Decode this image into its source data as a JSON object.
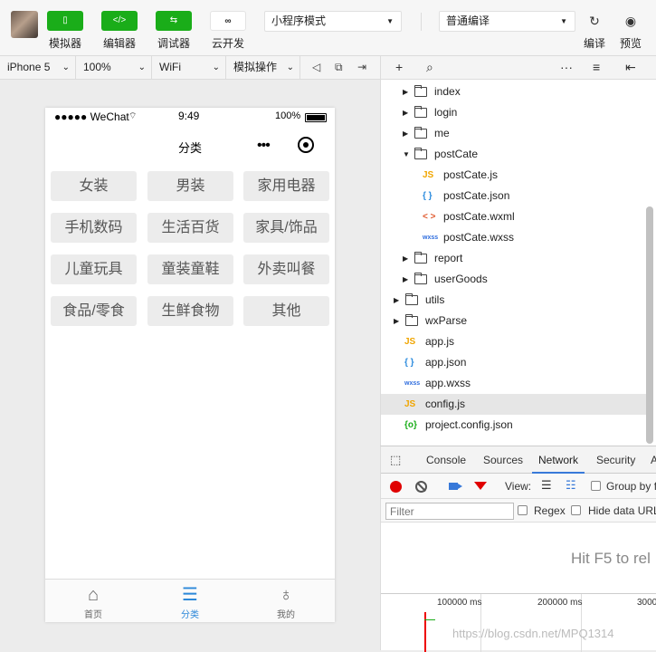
{
  "toolbar": {
    "buttons": [
      {
        "label": "模拟器",
        "icon": "phone-icon"
      },
      {
        "label": "编辑器",
        "icon": "code-icon"
      },
      {
        "label": "调试器",
        "icon": "debug-icon"
      },
      {
        "label": "云开发",
        "icon": "cloud-icon"
      }
    ],
    "mode_select": "小程序模式",
    "compile_select": "普通编译",
    "compile_label": "编译",
    "preview_label": "预览"
  },
  "simbar": {
    "device": "iPhone 5",
    "zoom": "100%",
    "network": "WiFi",
    "ops": "模拟操作"
  },
  "phone": {
    "status": {
      "carrier": "●●●●● WeChat",
      "time": "9:49",
      "battery": "100%"
    },
    "nav_title": "分类",
    "capsule_dots": "•••",
    "categories": [
      "女装",
      "男装",
      "家用电器",
      "手机数码",
      "生活百货",
      "家具/饰品",
      "儿童玩具",
      "童装童鞋",
      "外卖叫餐",
      "食品/零食",
      "生鲜食物",
      "其他"
    ],
    "tabs": [
      {
        "label": "首页",
        "icon": "home-icon"
      },
      {
        "label": "分类",
        "icon": "category-search-icon"
      },
      {
        "label": "我的",
        "icon": "user-icon"
      }
    ]
  },
  "tree": {
    "items": [
      {
        "name": "index",
        "type": "folder",
        "expanded": false
      },
      {
        "name": "login",
        "type": "folder",
        "expanded": false
      },
      {
        "name": "me",
        "type": "folder",
        "expanded": false
      },
      {
        "name": "postCate",
        "type": "folder",
        "expanded": true
      },
      {
        "name": "postCate.js",
        "type": "js"
      },
      {
        "name": "postCate.json",
        "type": "json"
      },
      {
        "name": "postCate.wxml",
        "type": "wxml"
      },
      {
        "name": "postCate.wxss",
        "type": "wxss"
      },
      {
        "name": "report",
        "type": "folder",
        "expanded": false
      },
      {
        "name": "userGoods",
        "type": "folder",
        "expanded": false
      },
      {
        "name": "utils",
        "type": "folder",
        "expanded": false
      },
      {
        "name": "wxParse",
        "type": "folder",
        "expanded": false
      },
      {
        "name": "app.js",
        "type": "js"
      },
      {
        "name": "app.json",
        "type": "json"
      },
      {
        "name": "app.wxss",
        "type": "wxss"
      },
      {
        "name": "config.js",
        "type": "js",
        "selected": true
      },
      {
        "name": "project.config.json",
        "type": "pjson"
      }
    ],
    "icon_glyphs": {
      "js": "JS",
      "json": "{ }",
      "wxml": "< >",
      "wxss": "wxss",
      "pjson": "{o}"
    }
  },
  "devtools": {
    "tabs": [
      "Console",
      "Sources",
      "Network",
      "Security",
      "A"
    ],
    "active_tab": "Network",
    "view_label": "View:",
    "group_label": "Group by f",
    "filter_placeholder": "Filter",
    "regex_label": "Regex",
    "hide_data_label": "Hide data URL",
    "hint": "Hit F5 to rel",
    "ticks": [
      "100000 ms",
      "200000 ms",
      "3000"
    ]
  },
  "watermark": "https://blog.csdn.net/MPQ1314",
  "colors": {
    "green": "#1aad19",
    "blue_active": "#2c88d9",
    "record_red": "#e00000"
  }
}
